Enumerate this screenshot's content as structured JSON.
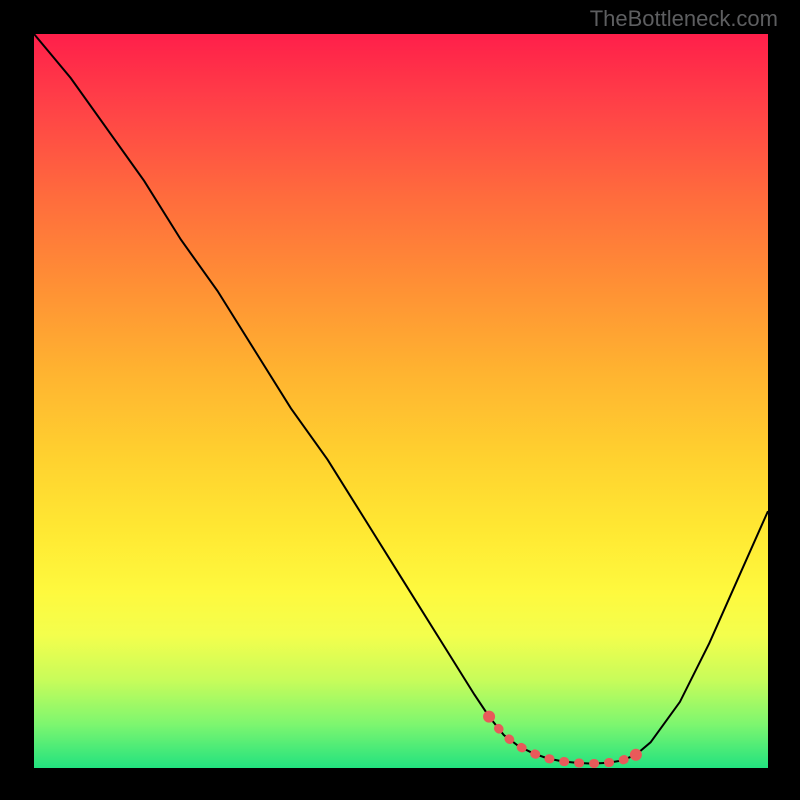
{
  "watermark": "TheBottleneck.com",
  "chart_data": {
    "type": "line",
    "title": "",
    "xlabel": "",
    "ylabel": "",
    "xlim": [
      0,
      100
    ],
    "ylim": [
      0,
      100
    ],
    "series": [
      {
        "name": "main-curve",
        "color": "#000000",
        "x": [
          0,
          5,
          10,
          15,
          20,
          25,
          30,
          35,
          40,
          45,
          50,
          55,
          60,
          62,
          64,
          66,
          68,
          70,
          72,
          74,
          76,
          78,
          80,
          82,
          84,
          88,
          92,
          96,
          100
        ],
        "y": [
          100,
          94,
          87,
          80,
          72,
          65,
          57,
          49,
          42,
          34,
          26,
          18,
          10,
          7,
          4.5,
          3,
          2,
          1.3,
          0.9,
          0.7,
          0.6,
          0.7,
          1.0,
          1.8,
          3.5,
          9,
          17,
          26,
          35
        ]
      },
      {
        "name": "highlight-segment",
        "color": "#e85a5a",
        "style": "thick-dotted",
        "x": [
          62,
          64,
          66,
          68,
          70,
          72,
          74,
          76,
          78,
          80,
          82
        ],
        "y": [
          7,
          4.5,
          3,
          2,
          1.3,
          0.9,
          0.7,
          0.6,
          0.7,
          1.0,
          1.8
        ]
      }
    ],
    "background_gradient_meaning": "severity scale (red=high, green=low)"
  }
}
